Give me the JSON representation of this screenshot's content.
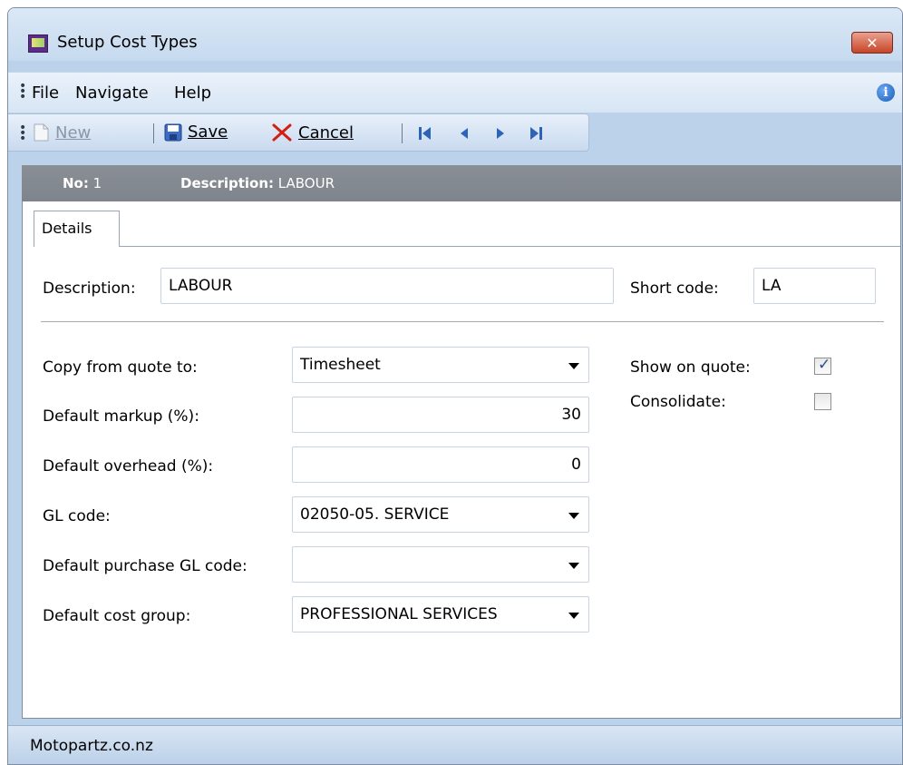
{
  "window": {
    "title": "Setup Cost Types",
    "close_glyph": "✕"
  },
  "menu": {
    "items": [
      "File",
      "Navigate",
      "Help"
    ]
  },
  "toolbar": {
    "new_label": "New",
    "save_label": "Save",
    "cancel_label": "Cancel",
    "icons": [
      "new-icon",
      "save-icon",
      "cancel-icon",
      "first-record-icon",
      "previous-record-icon",
      "next-record-icon",
      "last-record-icon"
    ]
  },
  "header": {
    "no_label": "No:",
    "no_value": "1",
    "description_label": "Description:",
    "description_value": "LABOUR"
  },
  "tabs": [
    "Details"
  ],
  "form": {
    "description_label": "Description:",
    "description_value": "LABOUR",
    "short_code_label": "Short code:",
    "short_code_value": "LA",
    "copy_from_quote_label": "Copy from quote to:",
    "copy_from_quote_value": "Timesheet",
    "default_markup_label": "Default markup (%):",
    "default_markup_value": "30",
    "default_overhead_label": "Default overhead (%):",
    "default_overhead_value": "0",
    "gl_code_label": "GL code:",
    "gl_code_value": "02050-05. SERVICE",
    "default_purchase_gl_label": "Default purchase GL code:",
    "default_purchase_gl_value": "",
    "default_cost_group_label": "Default cost group:",
    "default_cost_group_value": "PROFESSIONAL SERVICES",
    "show_on_quote_label": "Show on quote:",
    "show_on_quote_checked": true,
    "consolidate_label": "Consolidate:",
    "consolidate_checked": false
  },
  "status": {
    "text": "Motopartz.co.nz"
  },
  "colors": {
    "header_band": "#848a91",
    "chrome": "#bcd2ea",
    "close": "#c74529"
  }
}
